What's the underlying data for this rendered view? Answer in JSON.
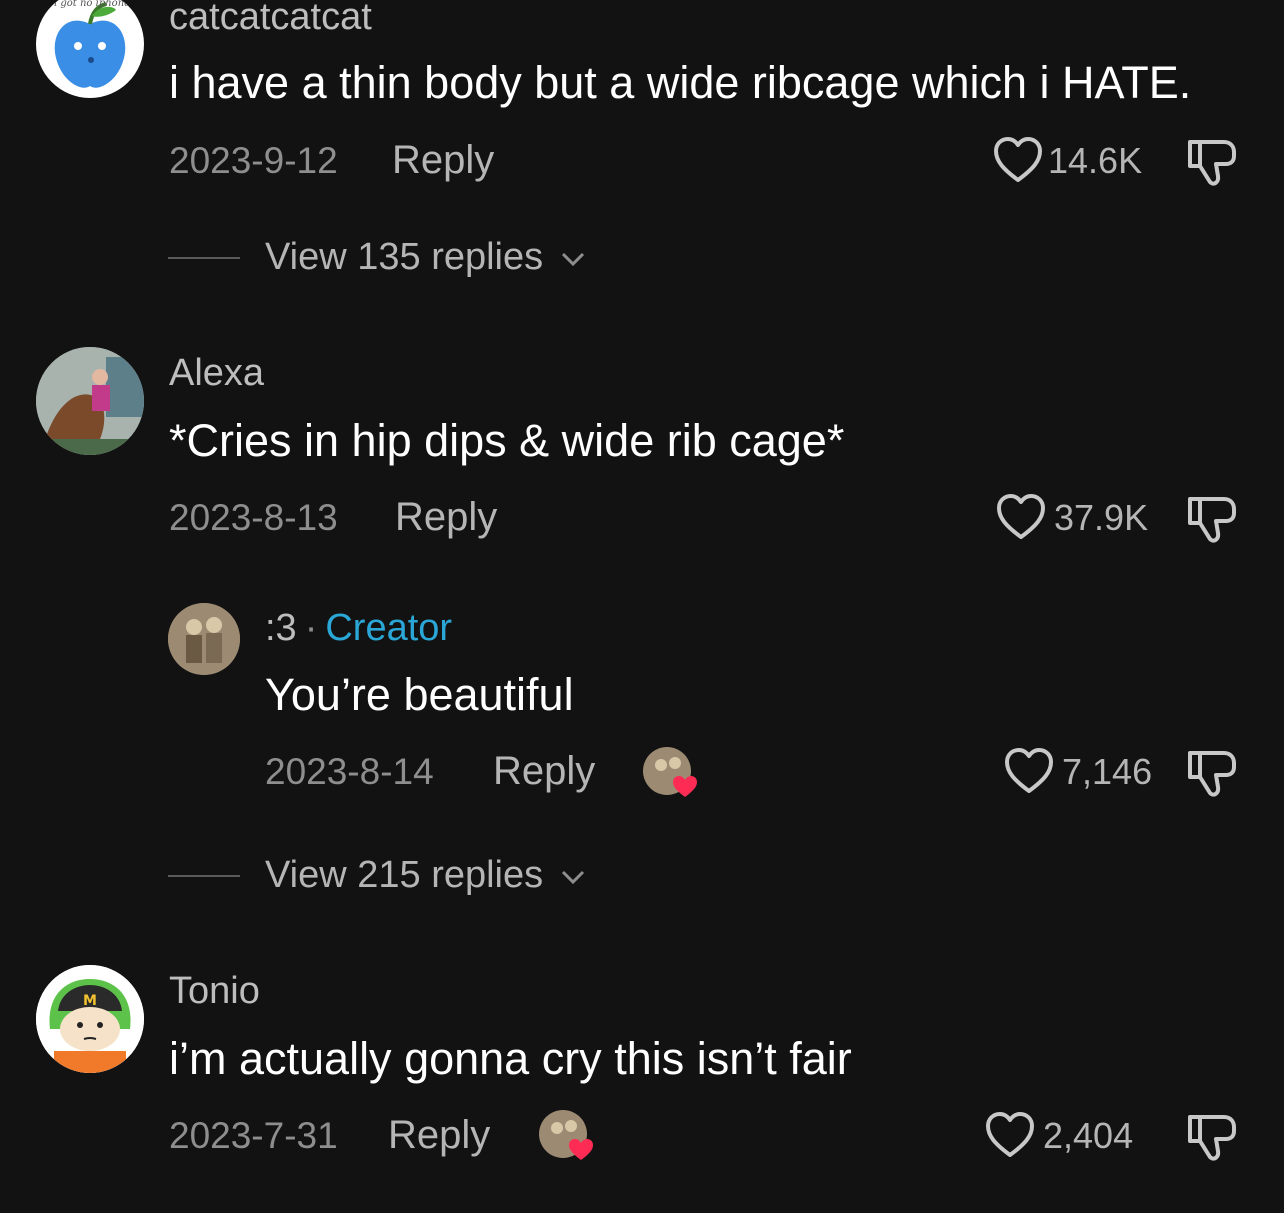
{
  "comments": [
    {
      "username": "catcatcatcat",
      "avatar_caption": "i got no iphone",
      "text": "i have a thin body but a wide ribcage which i HATE.",
      "date": "2023-9-12",
      "reply_label": "Reply",
      "likes": "14.6K",
      "view_replies": "View 135 replies"
    },
    {
      "username": "Alexa",
      "text": "*Cries in hip dips & wide rib cage*",
      "date": "2023-8-13",
      "reply_label": "Reply",
      "likes": "37.9K",
      "sub_reply": {
        "username": ":3",
        "separator": "·",
        "badge": "Creator",
        "text": "You’re beautiful",
        "date": "2023-8-14",
        "reply_label": "Reply",
        "likes": "7,146"
      },
      "view_replies": "View 215 replies"
    },
    {
      "username": "Tonio",
      "text": "i’m actually gonna cry this isn’t fair",
      "date": "2023-7-31",
      "reply_label": "Reply",
      "likes": "2,404"
    }
  ],
  "colors": {
    "background": "#121212",
    "creator_badge": "#2aa7d6",
    "creator_heart": "#fe2c55"
  },
  "icons": [
    "heart-outline-icon",
    "dislike-icon",
    "chevron-down-icon",
    "creator-liked-heart-icon"
  ]
}
